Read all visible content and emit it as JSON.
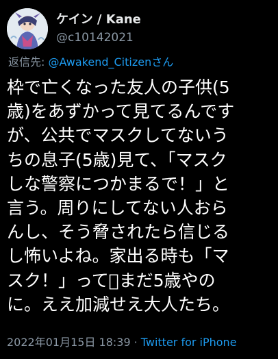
{
  "user": {
    "display_name": "ケイン / Kane",
    "handle": "@c10142021"
  },
  "reply": {
    "prefix": "返信先: ",
    "mention": "@Awakend_Citizen",
    "suffix": "さん"
  },
  "tweet": {
    "lines": [
      "枠で亡くなった友人の子供(5",
      "歳)をあずかって見てるんです",
      "が、公共でマスクしてないう",
      "ちの息子(5歳)見て、「マスク",
      "しな警察につかまるで！」と",
      "言う。周りにしてない人おら",
      "んし、そう脅されたら信じる",
      "し怖いよね。家出る時も「マ",
      "スク！」って􏿾まだ5歳やの",
      "に。ええ加減せえ大人たち。"
    ]
  },
  "footer": {
    "timestamp": "2022年01月15日 18:39",
    "separator": "·",
    "source": "Twitter for iPhone"
  },
  "colors": {
    "background": "#000000",
    "text": "#ffffff",
    "secondary": "#8b98a5",
    "link": "#1d9bf0"
  },
  "icons": {
    "avatar": "avatar-illustration"
  }
}
